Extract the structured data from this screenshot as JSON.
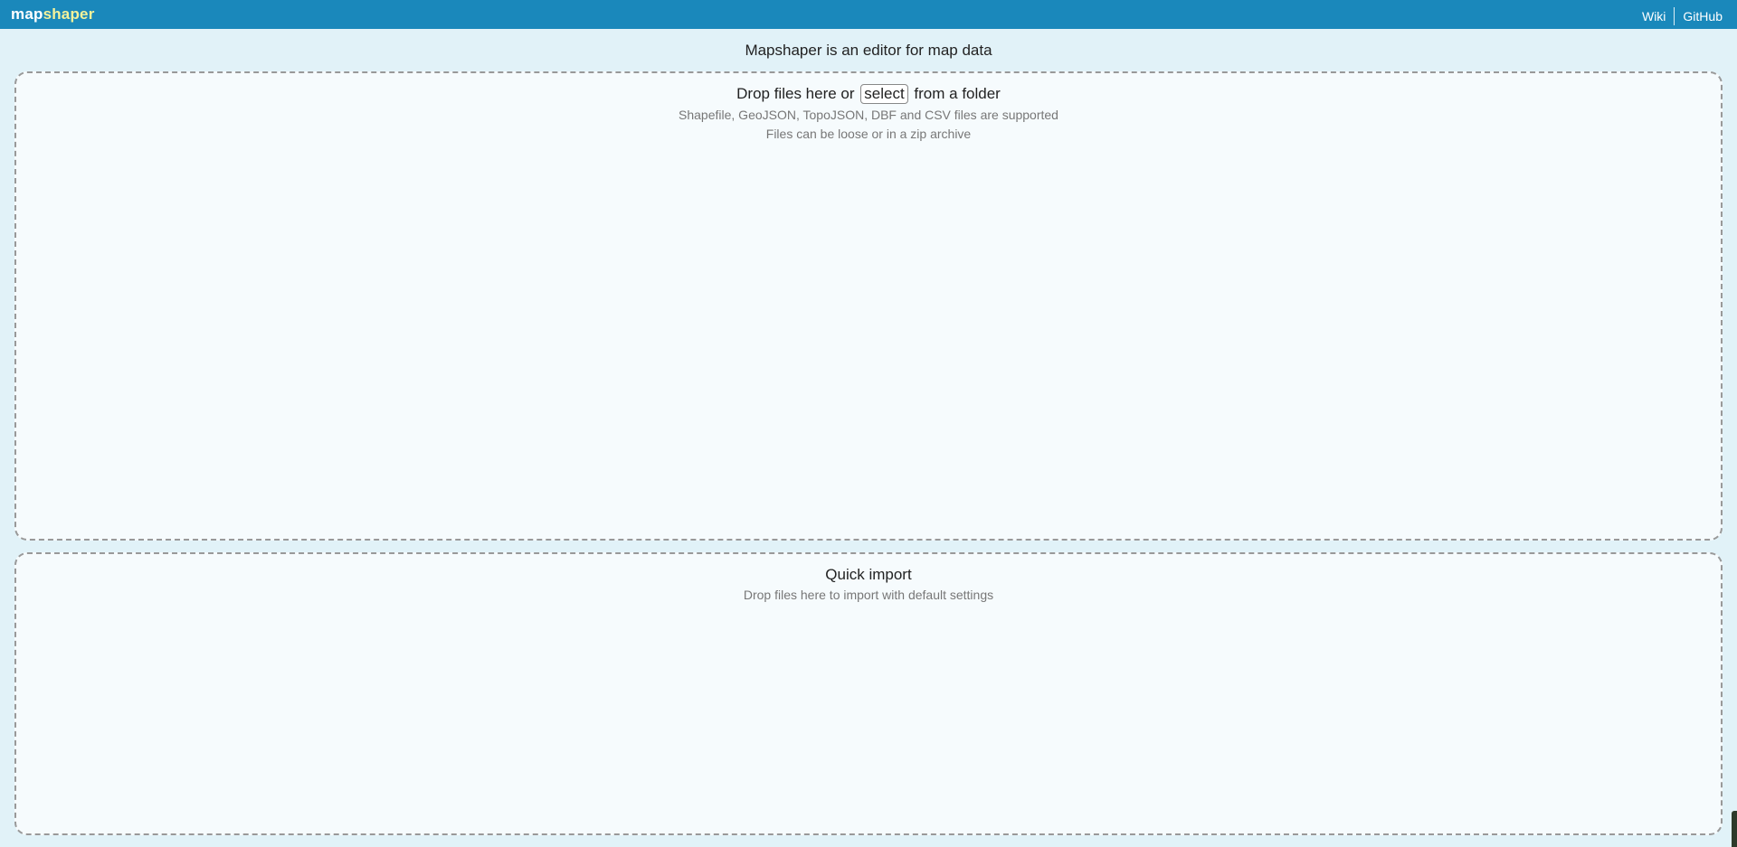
{
  "header": {
    "logo_part1": "map",
    "logo_part2": "shaper",
    "links": {
      "wiki": "Wiki",
      "github": "GitHub"
    }
  },
  "main_title": "Mapshaper is an editor for map data",
  "import_zone": {
    "heading_before": "Drop files here or",
    "select_label": "select",
    "heading_after": "from a folder",
    "supported_formats": "Shapefile, GeoJSON, TopoJSON, DBF and CSV files are supported",
    "archive_note": "Files can be loose or in a zip archive"
  },
  "quick_import_zone": {
    "heading": "Quick import",
    "subtitle": "Drop files here to import with default settings"
  },
  "colors": {
    "header_bg": "#1a88bb",
    "page_bg": "#e1f2f8",
    "logo_accent": "#f4f29a",
    "zone_border": "#999999"
  }
}
